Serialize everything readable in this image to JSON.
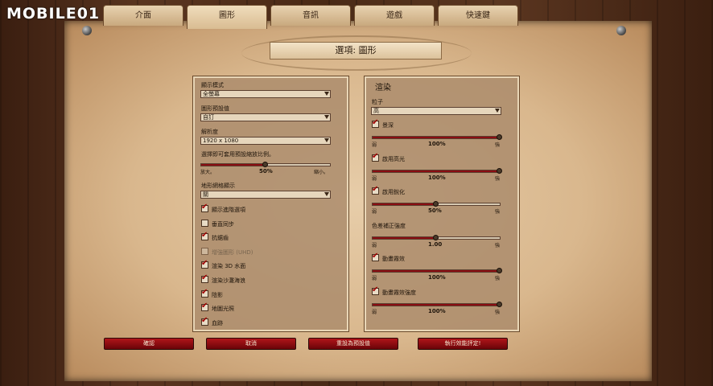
{
  "watermark": "MOBILE01",
  "tabs": [
    "介面",
    "圖形",
    "音訊",
    "遊戲",
    "快速鍵"
  ],
  "active_tab": "圖形",
  "dialog_title": "選項: 圖形",
  "left_panel": {
    "display_mode_label": "顯示模式",
    "display_mode_value": "全螢幕",
    "preset_label": "圖形預設值",
    "preset_value": "自訂",
    "resolution_label": "解析度",
    "resolution_value": "1920 x 1080",
    "ui_scale_label": "選擇即可套用預設縮放比例。",
    "ui_scale_min": "放大。",
    "ui_scale_value": "50%",
    "ui_scale_max": "縮小。",
    "ui_scale_fraction": 0.5,
    "grid_label": "地形網格顯示",
    "grid_value": "關",
    "checkboxes": [
      {
        "label": "顯示進階選項",
        "checked": true,
        "disabled": false
      },
      {
        "label": "垂直同步",
        "checked": false,
        "disabled": false
      },
      {
        "label": "抗鋸齒",
        "checked": true,
        "disabled": false
      },
      {
        "label": "增強圖形 (UHD)",
        "checked": false,
        "disabled": true
      },
      {
        "label": "渲染 3D 水面",
        "checked": true,
        "disabled": false
      },
      {
        "label": "渲染沙灘海浪",
        "checked": true,
        "disabled": false
      },
      {
        "label": "陰影",
        "checked": true,
        "disabled": false
      },
      {
        "label": "地圖光照",
        "checked": true,
        "disabled": false
      },
      {
        "label": "血跡",
        "checked": true,
        "disabled": false
      }
    ]
  },
  "right_panel": {
    "title": "渲染",
    "particles_label": "粒子",
    "particles_value": "高",
    "slider_groups": [
      {
        "label": "景深",
        "checked": true,
        "min": "弱",
        "max": "強",
        "value": "100%",
        "fraction": 1.0
      },
      {
        "label": "啟用高光",
        "checked": true,
        "min": "弱",
        "max": "強",
        "value": "100%",
        "fraction": 1.0
      },
      {
        "label": "啟用銳化",
        "checked": true,
        "min": "弱",
        "max": "強",
        "value": "50%",
        "fraction": 0.5
      },
      {
        "label": "色差補正強度",
        "checked": null,
        "min": "弱",
        "max": "強",
        "value": "1.00",
        "fraction": 0.5
      },
      {
        "label": "動畫霧效",
        "checked": true,
        "min": "弱",
        "max": "強",
        "value": "100%",
        "fraction": 1.0
      },
      {
        "label": "動畫霧效強度",
        "checked": true,
        "min": "弱",
        "max": "強",
        "value": "100%",
        "fraction": 1.0
      }
    ]
  },
  "buttons": {
    "confirm": "確認",
    "cancel": "取消",
    "reset": "重設為預設值",
    "benchmark": "執行效能評定!"
  }
}
